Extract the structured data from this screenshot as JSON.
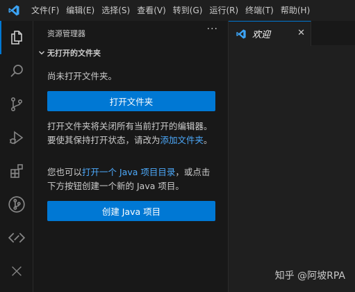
{
  "menu": {
    "items": [
      "文件(F)",
      "编辑(E)",
      "选择(S)",
      "查看(V)",
      "转到(G)",
      "运行(R)",
      "终端(T)",
      "帮助(H)"
    ]
  },
  "activity_bar": {
    "icons": [
      "explorer-icon",
      "search-icon",
      "source-control-icon",
      "run-debug-icon",
      "extensions-icon",
      "git-graph-icon",
      "remote-explorer-icon",
      "close-icon"
    ]
  },
  "sidebar": {
    "title": "资源管理器",
    "more": "···",
    "section": "无打开的文件夹",
    "no_folder_text": "尚未打开文件夹。",
    "open_folder_button": "打开文件夹",
    "desc_text": "打开文件夹将关闭所有当前打开的编辑器。要使其保持打开状态，请改为",
    "add_folder_link": "添加文件夹",
    "desc_end": "。",
    "java_text_1": "您也可以",
    "java_link": "打开一个 Java 项目目录",
    "java_text_2": "，或点击下方按钮创建一个新的 Java 项目。",
    "create_java_button": "创建 Java 项目"
  },
  "editor": {
    "tab_label": "欢迎",
    "tab_close": "✕"
  },
  "watermark": "知乎 @阿坡RPA",
  "colors": {
    "accent": "#0078d4",
    "link": "#4daafc",
    "vscode_blue": "#3ca3f4"
  }
}
